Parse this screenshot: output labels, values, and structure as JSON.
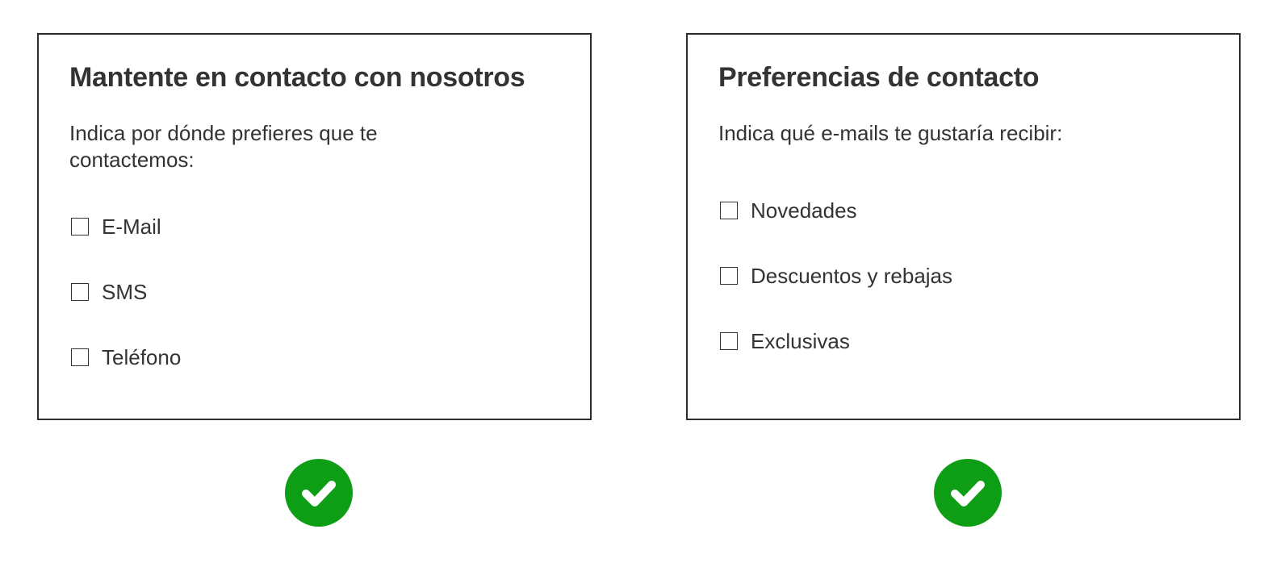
{
  "left_panel": {
    "title": "Mantente en contacto con nosotros",
    "description": "Indica por dónde prefieres que te contactemos:",
    "options": [
      {
        "label": "E-Mail",
        "checked": false
      },
      {
        "label": "SMS",
        "checked": false
      },
      {
        "label": "Teléfono",
        "checked": false
      }
    ],
    "status_icon": "check-circle-icon"
  },
  "right_panel": {
    "title": "Preferencias de contacto",
    "description": "Indica qué e-mails te gustaría recibir:",
    "options": [
      {
        "label": "Novedades",
        "checked": false
      },
      {
        "label": "Descuentos y rebajas",
        "checked": false
      },
      {
        "label": "Exclusivas",
        "checked": false
      }
    ],
    "status_icon": "check-circle-icon"
  },
  "colors": {
    "success": "#0d9e16",
    "text": "#333333",
    "border": "#2b2b2b"
  }
}
